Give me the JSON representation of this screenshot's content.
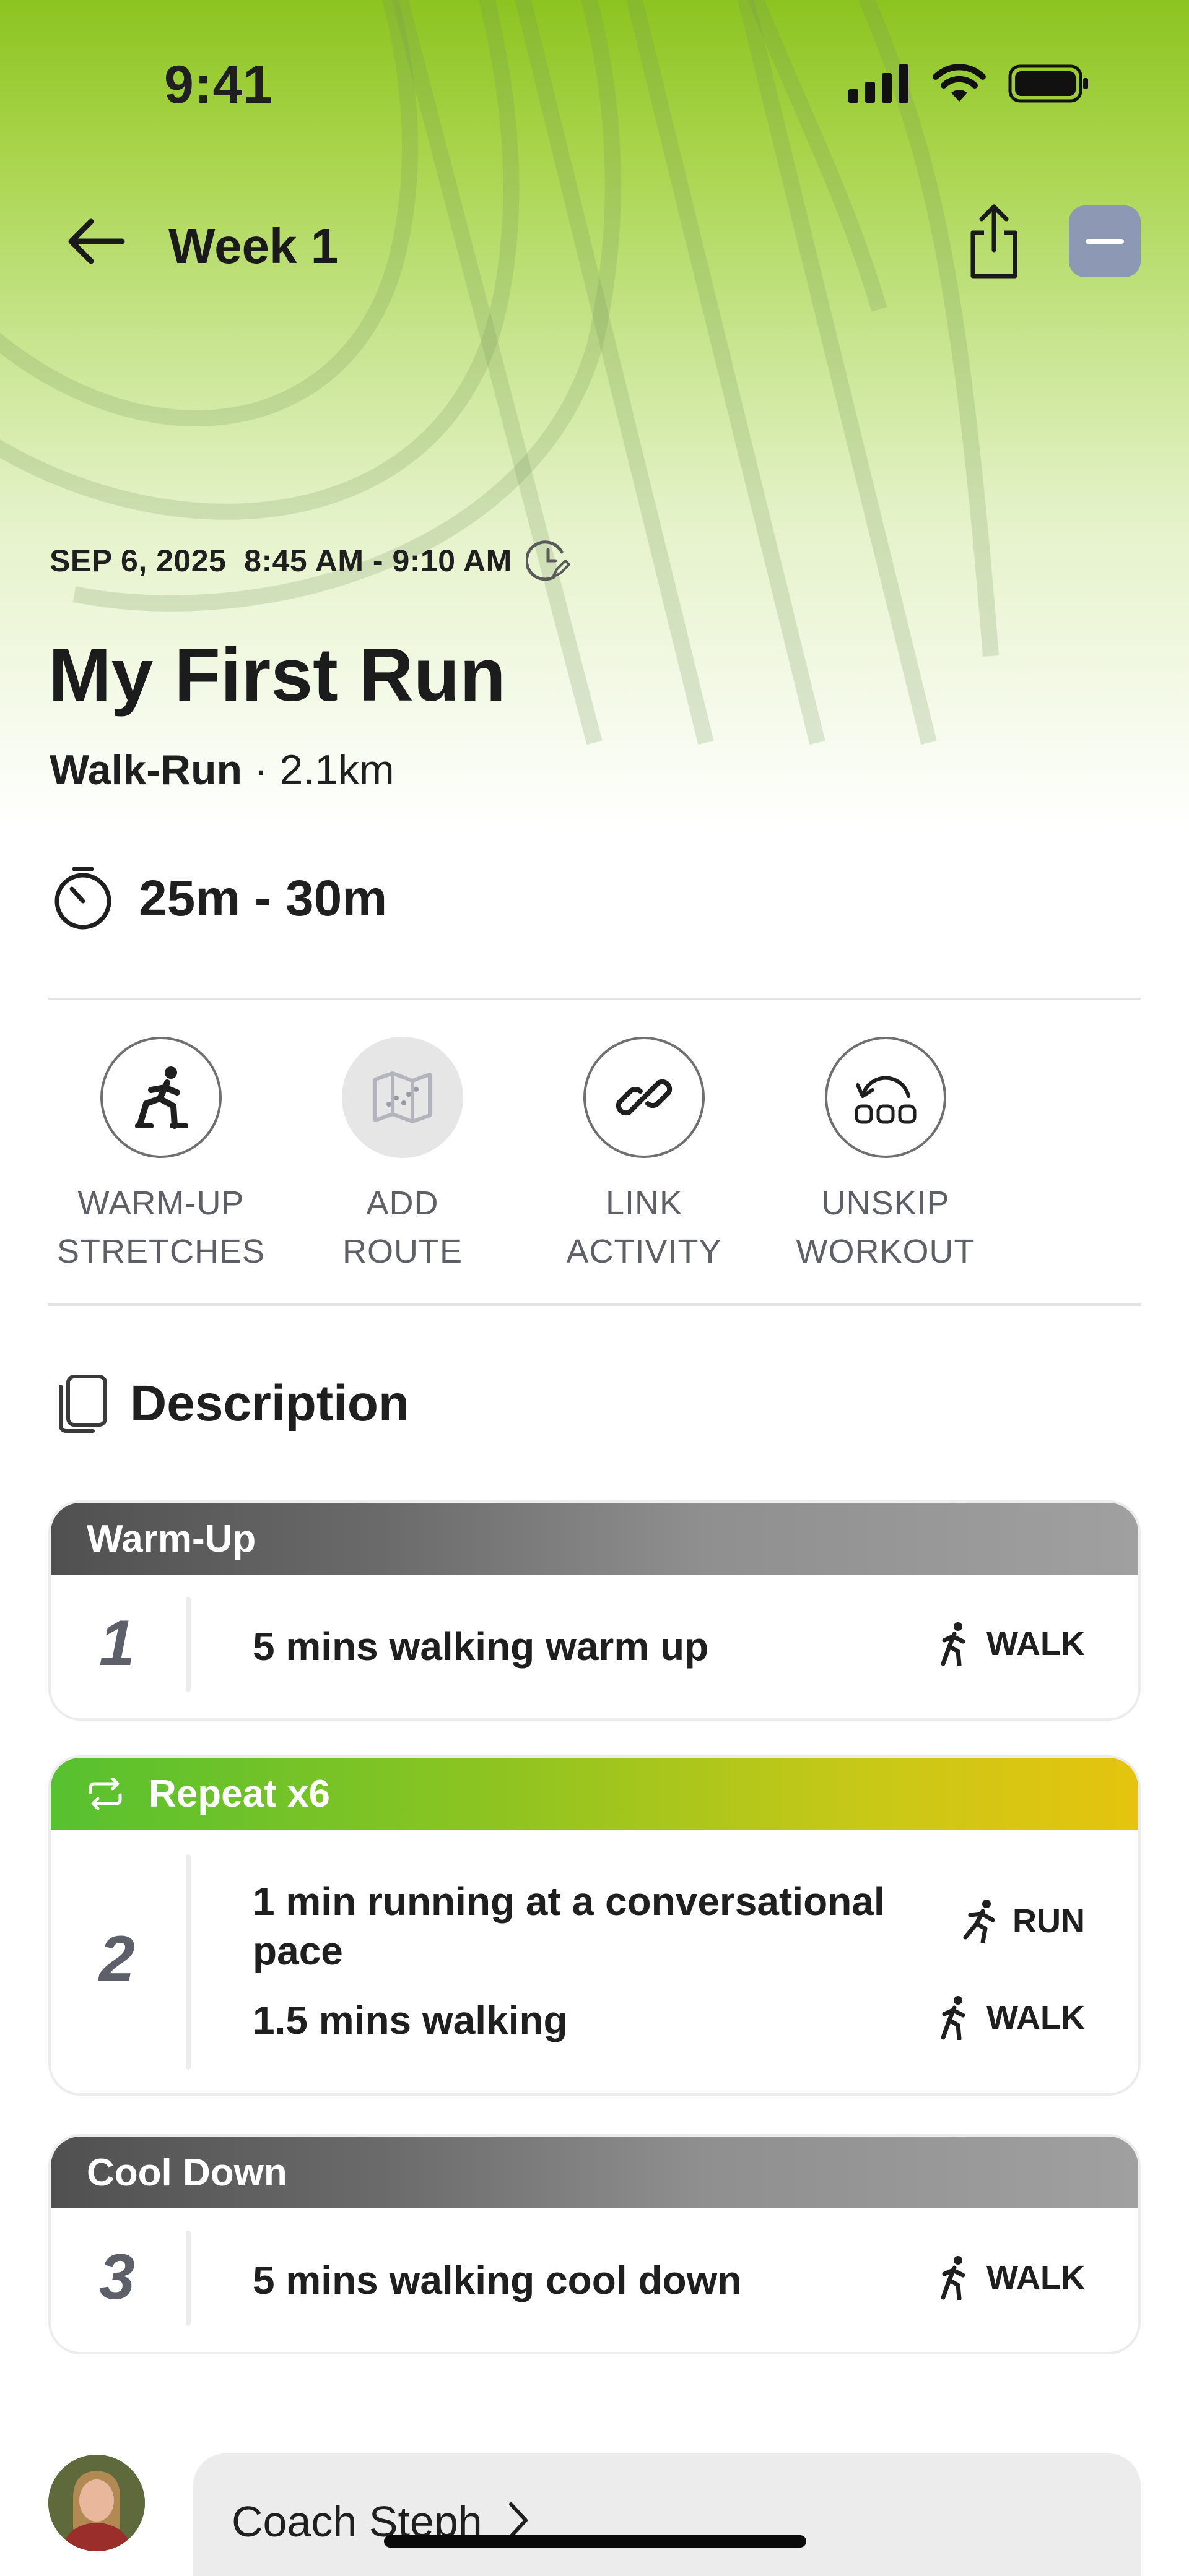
{
  "status_bar": {
    "time": "9:41"
  },
  "nav": {
    "title": "Week 1",
    "back_icon": "arrow-left-icon",
    "share_icon": "share-icon",
    "more_icon": "minus-icon"
  },
  "workout": {
    "datetime": "SEP 6, 2025  8:45 AM - 9:10 AM",
    "title": "My First Run",
    "type": "Walk-Run",
    "distance": "· 2.1km",
    "duration": "25m - 30m"
  },
  "actions": [
    {
      "line1": "WARM-UP",
      "line2": "STRETCHES",
      "icon": "stretch-icon"
    },
    {
      "line1": "ADD",
      "line2": "ROUTE",
      "icon": "map-icon"
    },
    {
      "line1": "LINK",
      "line2": "ACTIVITY",
      "icon": "link-icon"
    },
    {
      "line1": "UNSKIP",
      "line2": "WORKOUT",
      "icon": "unskip-icon"
    }
  ],
  "description": {
    "heading": "Description",
    "blocks": [
      {
        "header": "Warm-Up",
        "number": "1",
        "steps": [
          {
            "text": "5 mins walking warm up",
            "tag": "WALK"
          }
        ]
      },
      {
        "header": "Repeat x6",
        "number": "2",
        "steps": [
          {
            "text": "1 min running at a conversational pace",
            "tag": "RUN"
          },
          {
            "text": "1.5 mins walking",
            "tag": "WALK"
          }
        ]
      },
      {
        "header": "Cool Down",
        "number": "3",
        "steps": [
          {
            "text": "5 mins walking cool down",
            "tag": "WALK"
          }
        ]
      }
    ]
  },
  "coach": {
    "name": "Coach Steph"
  },
  "colors": {
    "accent_green": "#8cc420",
    "repeat_gradient_end": "#e5c40e",
    "block_gray": "#505050"
  }
}
